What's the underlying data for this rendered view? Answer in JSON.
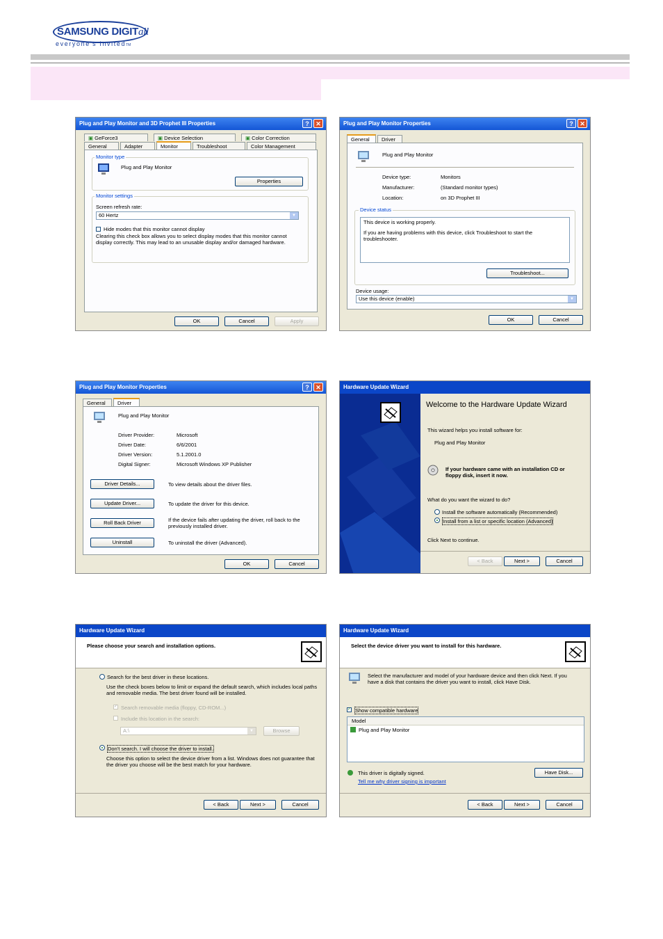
{
  "header": {
    "logo_main": "SAMSUNG DIGIT",
    "logo_suffix": "all",
    "logo_tagline": "everyone's Invited",
    "logo_tm": "TM"
  },
  "colors": {
    "accent_pink": "#fbe6f7",
    "xp_title": "#1456d6",
    "xp_face": "#ece9d8",
    "logo_blue": "#1a3f9a"
  },
  "win1": {
    "title": "Plug and Play Monitor and 3D Prophet III Properties",
    "tabs_row1": [
      "GeForce3",
      "Device Selection",
      "Color Correction"
    ],
    "tabs_row2": [
      "General",
      "Adapter",
      "Monitor",
      "Troubleshoot",
      "Color Management"
    ],
    "monitor_type_label": "Monitor type",
    "monitor_name": "Plug and Play Monitor",
    "properties_button": "Properties",
    "monitor_settings_label": "Monitor settings",
    "refresh_label": "Screen refresh rate:",
    "refresh_value": "60 Hertz",
    "hide_modes_label": "Hide modes that this monitor cannot display",
    "hide_modes_desc": "Clearing this check box allows you to select display modes that this monitor cannot display correctly. This may lead to an unusable display and/or damaged hardware.",
    "ok": "OK",
    "cancel": "Cancel",
    "apply": "Apply"
  },
  "win2": {
    "title": "Plug and Play Monitor Properties",
    "tabs": [
      "General",
      "Driver"
    ],
    "device_name": "Plug and Play Monitor",
    "device_type_label": "Device type:",
    "device_type_value": "Monitors",
    "manufacturer_label": "Manufacturer:",
    "manufacturer_value": "(Standard monitor types)",
    "location_label": "Location:",
    "location_value": "on 3D Prophet III",
    "status_label": "Device status",
    "status_line1": "This device is working properly.",
    "status_line2": "If you are having problems with this device, click Troubleshoot to start the troubleshooter.",
    "troubleshoot_button": "Troubleshoot...",
    "usage_label": "Device usage:",
    "usage_value": "Use this device (enable)",
    "ok": "OK",
    "cancel": "Cancel"
  },
  "win3": {
    "title": "Plug and Play Monitor Properties",
    "tabs": [
      "General",
      "Driver"
    ],
    "device_name": "Plug and Play Monitor",
    "provider_label": "Driver Provider:",
    "provider_value": "Microsoft",
    "date_label": "Driver Date:",
    "date_value": "6/6/2001",
    "version_label": "Driver Version:",
    "version_value": "5.1.2001.0",
    "signer_label": "Digital Signer:",
    "signer_value": "Microsoft Windows XP Publisher",
    "buttons": [
      {
        "label": "Driver Details...",
        "desc": "To view details about the driver files."
      },
      {
        "label": "Update Driver...",
        "desc": "To update the driver for this device."
      },
      {
        "label": "Roll Back Driver",
        "desc": "If the device fails after updating the driver, roll back to the previously installed driver."
      },
      {
        "label": "Uninstall",
        "desc": "To uninstall the driver (Advanced)."
      }
    ],
    "ok": "OK",
    "cancel": "Cancel"
  },
  "win4": {
    "title": "Hardware Update Wizard",
    "heading": "Welcome to the Hardware Update Wizard",
    "intro": "This wizard helps you install software for:",
    "device": "Plug and Play Monitor",
    "cd_note": "If your hardware came with an installation CD or floppy disk, insert it now.",
    "question": "What do you want the wizard to do?",
    "option_auto": "Install the software automatically (Recommended)",
    "option_list": "Install from a list or specific location (Advanced)",
    "continue": "Click Next to continue.",
    "back": "< Back",
    "next": "Next >",
    "cancel": "Cancel"
  },
  "win5": {
    "title": "Hardware Update Wizard",
    "heading": "Please choose your search and installation options.",
    "search_option": "Search for the best driver in these locations.",
    "search_desc": "Use the check boxes below to limit or expand the default search, which includes local paths and removable media. The best driver found will be installed.",
    "search_removable": "Search removable media (floppy, CD-ROM...)",
    "include_location": "Include this location in the search:",
    "path_value": "A:\\",
    "browse": "Browse",
    "dont_search": "Don't search. I will choose the driver to install.",
    "dont_search_desc": "Choose this option to select the device driver from a list. Windows does not guarantee that the driver you choose will be the best match for your hardware.",
    "back": "< Back",
    "next": "Next >",
    "cancel": "Cancel"
  },
  "win6": {
    "title": "Hardware Update Wizard",
    "heading": "Select the device driver you want to install for this hardware.",
    "instructions": "Select the manufacturer and model of your hardware device and then click Next. If you have a disk that contains the driver you want to install, click Have Disk.",
    "show_compatible": "Show compatible hardware",
    "model_header": "Model",
    "model_item": "Plug and Play Monitor",
    "signed_note": "This driver is digitally signed.",
    "signing_link": "Tell me why driver signing is important",
    "have_disk": "Have Disk...",
    "back": "< Back",
    "next": "Next >",
    "cancel": "Cancel"
  }
}
